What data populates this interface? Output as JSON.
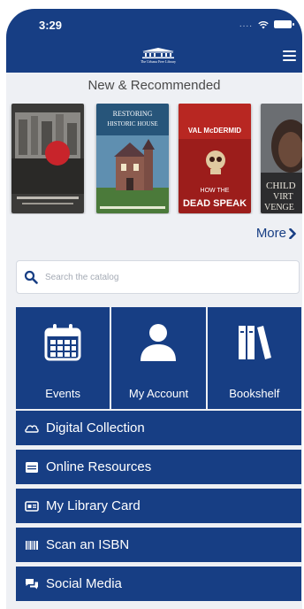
{
  "status_bar": {
    "time": "3:29"
  },
  "header": {
    "logo_text": "The Urbana Free Library"
  },
  "recommended": {
    "title": "New & Recommended",
    "more_label": "More"
  },
  "books": [
    {
      "cover_text": ""
    },
    {
      "cover_text": "RESTORING an HISTORIC HOUSE"
    },
    {
      "cover_text": "VAL McDERMID HOW THE DEAD SPEAK"
    },
    {
      "cover_text": "CHILD VIRT VENGE"
    }
  ],
  "search": {
    "placeholder": "Search the catalog"
  },
  "tiles": [
    {
      "label": "Events",
      "icon": "calendar-icon"
    },
    {
      "label": "My Account",
      "icon": "person-icon"
    },
    {
      "label": "Bookshelf",
      "icon": "books-icon"
    }
  ],
  "menu_items": [
    {
      "label": "Digital Collection",
      "icon": "cloud-icon"
    },
    {
      "label": "Online Resources",
      "icon": "browser-icon"
    },
    {
      "label": "My Library Card",
      "icon": "card-icon"
    },
    {
      "label": "Scan an ISBN",
      "icon": "barcode-icon"
    },
    {
      "label": "Social Media",
      "icon": "chat-icon"
    }
  ],
  "colors": {
    "brand": "#173e84",
    "background": "#eef0f4",
    "text_muted": "#4a4a4a"
  }
}
